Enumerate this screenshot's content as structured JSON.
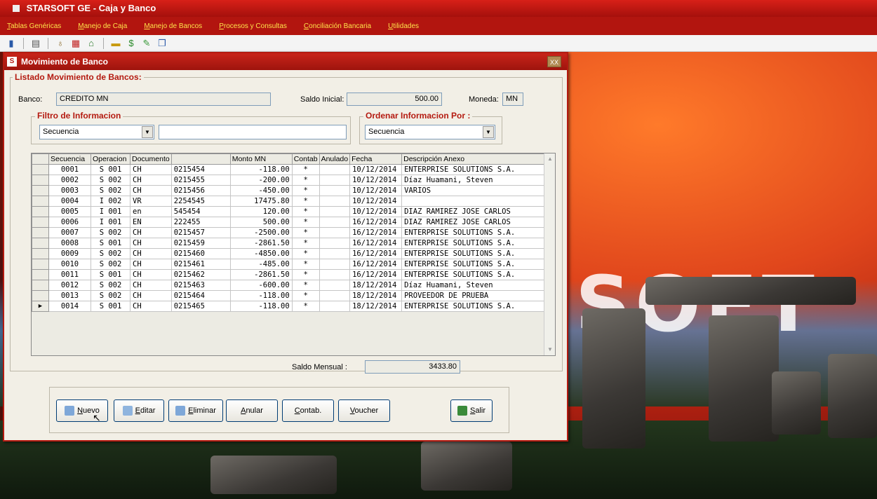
{
  "app": {
    "title": "STARSOFT GE   - Caja y Banco",
    "background_text": "SOFT"
  },
  "menu": [
    "Tablas Genéricas",
    "Manejo de Caja",
    "Manejo de Bancos",
    "Procesos y Consultas",
    "Conciliación Bancaria",
    "Utilidades"
  ],
  "toolbar_icons": [
    "exit-icon",
    "print-icon",
    "money-bag-icon",
    "calendar-icon",
    "home-icon",
    "cash-icon",
    "dollar-icon",
    "pencil-icon",
    "document-icon"
  ],
  "window": {
    "title": "Movimiento de Banco",
    "close_label": "XX"
  },
  "listado": {
    "legend": "Listado Movimiento de Bancos:",
    "banco_label": "Banco:",
    "banco_value": "CREDITO MN",
    "saldo_inicial_label": "Saldo Inicial:",
    "saldo_inicial_value": "500.00",
    "moneda_label": "Moneda:",
    "moneda_value": "MN"
  },
  "filtro": {
    "legend": "Filtro de Informacion",
    "select_value": "Secuencia",
    "text_value": ""
  },
  "ordenar": {
    "legend": "Ordenar Informacion Por :",
    "select_value": "Secuencia"
  },
  "grid": {
    "columns": [
      "Secuencia",
      "Operacion",
      "Documento",
      "",
      "Monto MN",
      "Contab",
      "Anulado",
      "Fecha",
      "Descripción Anexo"
    ],
    "rows": [
      [
        "0001",
        "S 001",
        "CH",
        "0215454",
        "-118.00",
        "*",
        "",
        "10/12/2014",
        "ENTERPRISE SOLUTIONS S.A."
      ],
      [
        "0002",
        "S 002",
        "CH",
        "0215455",
        "-200.00",
        "*",
        "",
        "10/12/2014",
        "Díaz Huamani, Steven"
      ],
      [
        "0003",
        "S 002",
        "CH",
        "0215456",
        "-450.00",
        "*",
        "",
        "10/12/2014",
        "VARIOS"
      ],
      [
        "0004",
        "I 002",
        "VR",
        "2254545",
        "17475.80",
        "*",
        "",
        "10/12/2014",
        ""
      ],
      [
        "0005",
        "I 001",
        "en",
        "545454",
        "120.00",
        "*",
        "",
        "10/12/2014",
        "DIAZ RAMIREZ JOSE CARLOS"
      ],
      [
        "0006",
        "I 001",
        "EN",
        "222455",
        "500.00",
        "*",
        "",
        "16/12/2014",
        "DIAZ RAMIREZ JOSE CARLOS"
      ],
      [
        "0007",
        "S 002",
        "CH",
        "0215457",
        "-2500.00",
        "*",
        "",
        "16/12/2014",
        "ENTERPRISE SOLUTIONS S.A."
      ],
      [
        "0008",
        "S 001",
        "CH",
        "0215459",
        "-2861.50",
        "*",
        "",
        "16/12/2014",
        "ENTERPRISE SOLUTIONS S.A."
      ],
      [
        "0009",
        "S 002",
        "CH",
        "0215460",
        "-4850.00",
        "*",
        "",
        "16/12/2014",
        "ENTERPRISE SOLUTIONS S.A."
      ],
      [
        "0010",
        "S 002",
        "CH",
        "0215461",
        "-485.00",
        "*",
        "",
        "16/12/2014",
        "ENTERPRISE SOLUTIONS S.A."
      ],
      [
        "0011",
        "S 001",
        "CH",
        "0215462",
        "-2861.50",
        "*",
        "",
        "16/12/2014",
        "ENTERPRISE SOLUTIONS S.A."
      ],
      [
        "0012",
        "S 002",
        "CH",
        "0215463",
        "-600.00",
        "*",
        "",
        "18/12/2014",
        "Díaz Huamani, Steven"
      ],
      [
        "0013",
        "S 002",
        "CH",
        "0215464",
        "-118.00",
        "*",
        "",
        "18/12/2014",
        "PROVEEDOR DE PRUEBA"
      ],
      [
        "0014",
        "S 001",
        "CH",
        "0215465",
        "-118.00",
        "*",
        "",
        "18/12/2014",
        "ENTERPRISE SOLUTIONS S.A."
      ]
    ],
    "current_row_marker": "▶"
  },
  "saldo_mensual": {
    "label": "Saldo Mensual :",
    "value": "3433.80"
  },
  "buttons": {
    "nuevo": "Nuevo",
    "editar": "Editar",
    "eliminar": "Eliminar",
    "anular": "Anular",
    "contab": "Contab.",
    "voucher": "Voucher",
    "salir": "Salir"
  },
  "colors": {
    "accent": "#b41a10",
    "menu_text": "#ffe24a"
  }
}
